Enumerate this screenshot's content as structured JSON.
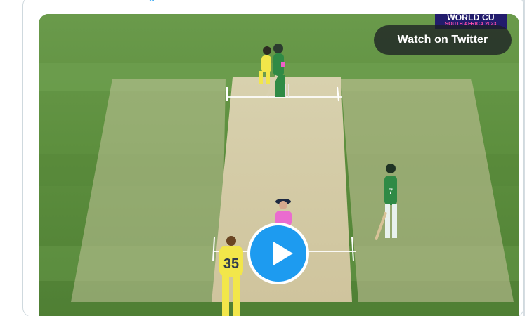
{
  "tweet": {
    "link_fragment": "p"
  },
  "video": {
    "watch_label": "Watch on Twitter",
    "badge": {
      "title": "WORLD CU",
      "subtitle": "SOUTH AFRICA 2023"
    },
    "jersey_numbers": {
      "bowler": "35",
      "non_striker": "7"
    },
    "colors": {
      "play_button": "#1d9bf0",
      "pitch": "#d2c9a3",
      "grass": "#5c8a3c",
      "australia_kit": "#f2e64a",
      "bangladesh_kit": "#2f8a45",
      "umpire_shirt": "#ea6ccf"
    }
  }
}
